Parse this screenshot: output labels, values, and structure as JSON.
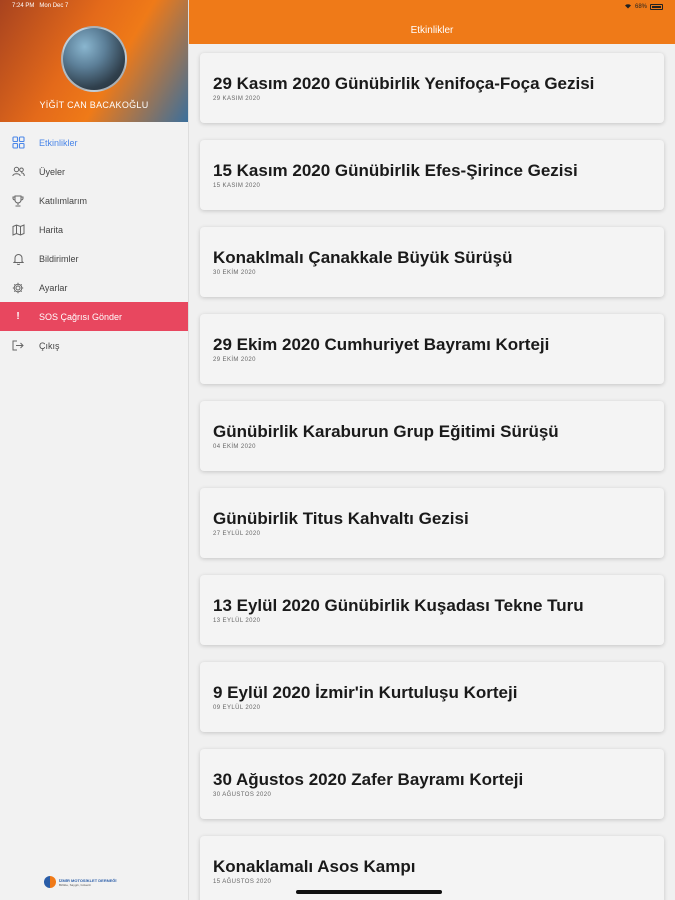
{
  "status_bar": {
    "time": "7:24 PM",
    "date": "Mon Dec 7",
    "battery": "68%"
  },
  "profile": {
    "name": "YİĞİT CAN BACAKOĞLU"
  },
  "menu": [
    {
      "label": "Etkinlikler",
      "icon": "grid-icon"
    },
    {
      "label": "Üyeler",
      "icon": "users-icon"
    },
    {
      "label": "Katılımlarım",
      "icon": "trophy-icon"
    },
    {
      "label": "Harita",
      "icon": "map-icon"
    },
    {
      "label": "Bildirimler",
      "icon": "bell-icon"
    },
    {
      "label": "Ayarlar",
      "icon": "gear-icon"
    },
    {
      "label": "SOS Çağrısı Gönder",
      "icon": "exclamation-icon"
    },
    {
      "label": "Çıkış",
      "icon": "logout-icon"
    }
  ],
  "logo": {
    "line1": "İZMİR MOTOSİKLET DERNEĞİ",
    "line2": "Birlikte, Saygılı, Güvenli"
  },
  "header": {
    "title": "Etkinlikler"
  },
  "events": [
    {
      "title": "29 Kasım 2020 Günübirlik Yenifoça-Foça Gezisi",
      "date": "29 KASIM 2020"
    },
    {
      "title": "15 Kasım 2020 Günübirlik Efes-Şirince Gezisi",
      "date": "15 KASIM 2020"
    },
    {
      "title": "Konaklmalı Çanakkale Büyük Sürüşü",
      "date": "30 EKİM 2020"
    },
    {
      "title": "29 Ekim 2020 Cumhuriyet Bayramı Korteji",
      "date": "29 EKİM 2020"
    },
    {
      "title": "Günübirlik Karaburun Grup Eğitimi Sürüşü",
      "date": "04 EKİM 2020"
    },
    {
      "title": "Günübirlik Titus Kahvaltı Gezisi",
      "date": "27 EYLÜL 2020"
    },
    {
      "title": "13 Eylül 2020 Günübirlik Kuşadası Tekne Turu",
      "date": "13 EYLÜL 2020"
    },
    {
      "title": "9 Eylül 2020 İzmir'in Kurtuluşu Korteji",
      "date": "09 EYLÜL 2020"
    },
    {
      "title": "30 Ağustos 2020 Zafer Bayramı Korteji",
      "date": "30 AĞUSTOS 2020"
    },
    {
      "title": "Konaklamalı Asos Kampı",
      "date": "15 AĞUSTOS 2020"
    }
  ],
  "colors": {
    "accent": "#ef7a18",
    "active": "#4a86e8",
    "sos": "#e8475f"
  }
}
